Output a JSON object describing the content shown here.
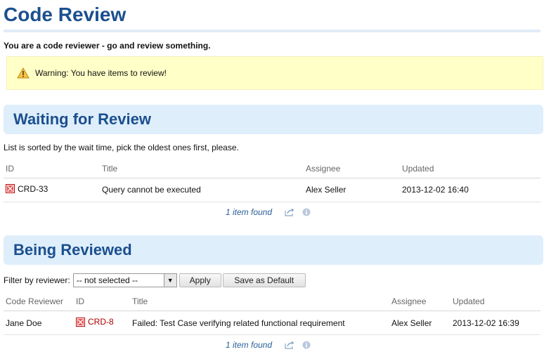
{
  "page": {
    "title": "Code Review",
    "intro": "You are a code reviewer - go and review something.",
    "warning": "Warning: You have items to review!"
  },
  "waiting": {
    "title": "Waiting for Review",
    "description": "List is sorted by the wait time, pick the oldest ones first, please.",
    "columns": [
      "ID",
      "Title",
      "Assignee",
      "Updated"
    ],
    "rows": [
      {
        "id": "CRD-33",
        "title": "Query cannot be executed",
        "assignee": "Alex Seller",
        "updated": "2013-12-02 16:40"
      }
    ],
    "footer": "1 item found"
  },
  "reviewed": {
    "title": "Being Reviewed",
    "filter_label": "Filter by reviewer:",
    "filter_value": "-- not selected --",
    "apply_label": "Apply",
    "save_default_label": "Save as Default",
    "columns": [
      "Code Reviewer",
      "ID",
      "Title",
      "Assignee",
      "Updated"
    ],
    "rows": [
      {
        "reviewer": "Jane Doe",
        "id": "CRD-8",
        "title": "Failed: Test Case verifying related functional requirement",
        "assignee": "Alex Seller",
        "updated": "2013-12-02 16:39"
      }
    ],
    "footer": "1 item found"
  },
  "colors": {
    "heading": "#1b4f8f",
    "section_bg": "#dfeefb",
    "warning_bg": "#ffffc8",
    "link": "#2a5f99",
    "id_red": "#aa0000"
  },
  "icons": [
    "warning-icon",
    "bug-icon",
    "export-icon",
    "info-icon",
    "dropdown-arrow-icon"
  ]
}
